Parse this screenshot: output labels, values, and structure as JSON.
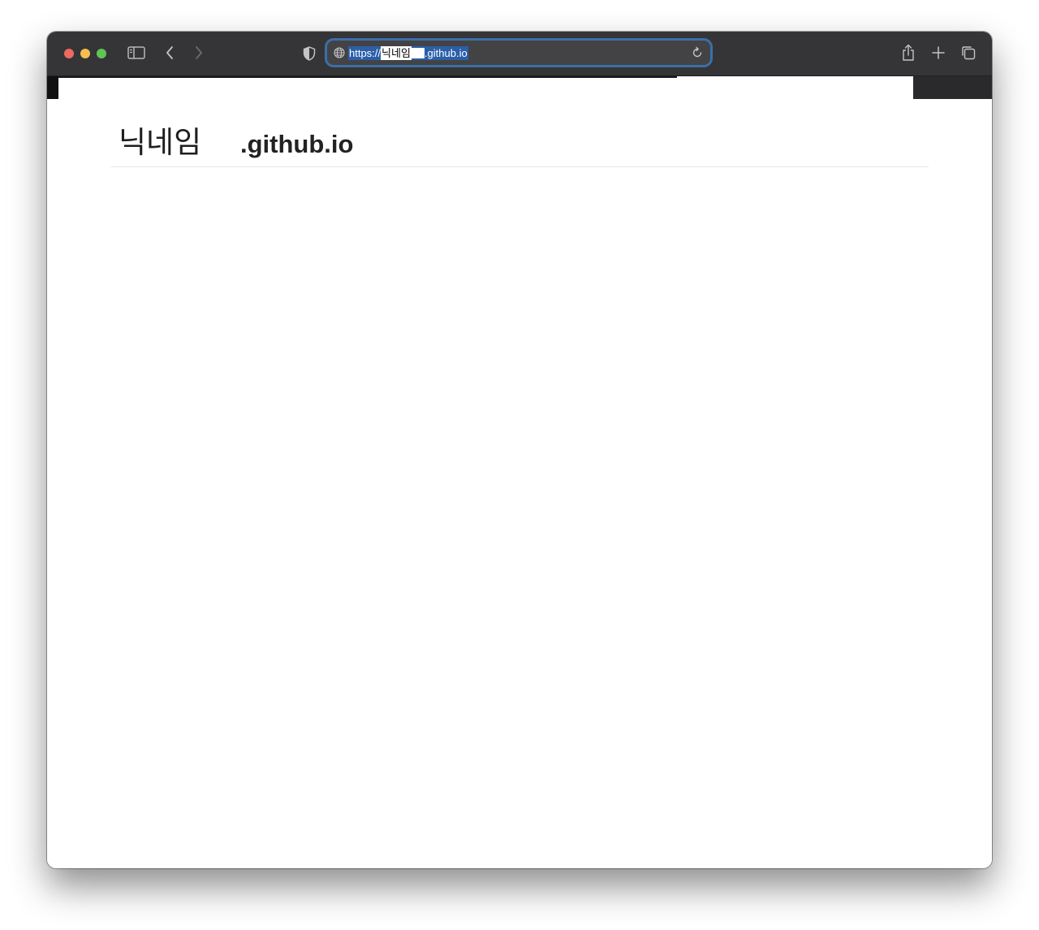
{
  "browser": {
    "url": {
      "prefix": "https://",
      "nickname": "닉네임",
      "suffix": ".github.io"
    },
    "icons": {
      "sidebar": "sidebar-icon",
      "back": "chevron-left-icon",
      "forward": "chevron-right-icon",
      "privacy": "shield-icon",
      "globe": "globe-icon",
      "reload": "reload-icon",
      "share": "share-icon",
      "new_tab": "plus-icon",
      "tab_overview": "tabs-icon"
    },
    "colors": {
      "toolbar": "#353537",
      "url_focus_ring": "#3b6fa8",
      "selection": "#2b5fa8",
      "close": "#ed6a5e",
      "minimize": "#f5bf4f",
      "maximize": "#61c554"
    }
  },
  "site": {
    "nickname": "닉네임",
    "domain": ".github.io"
  }
}
